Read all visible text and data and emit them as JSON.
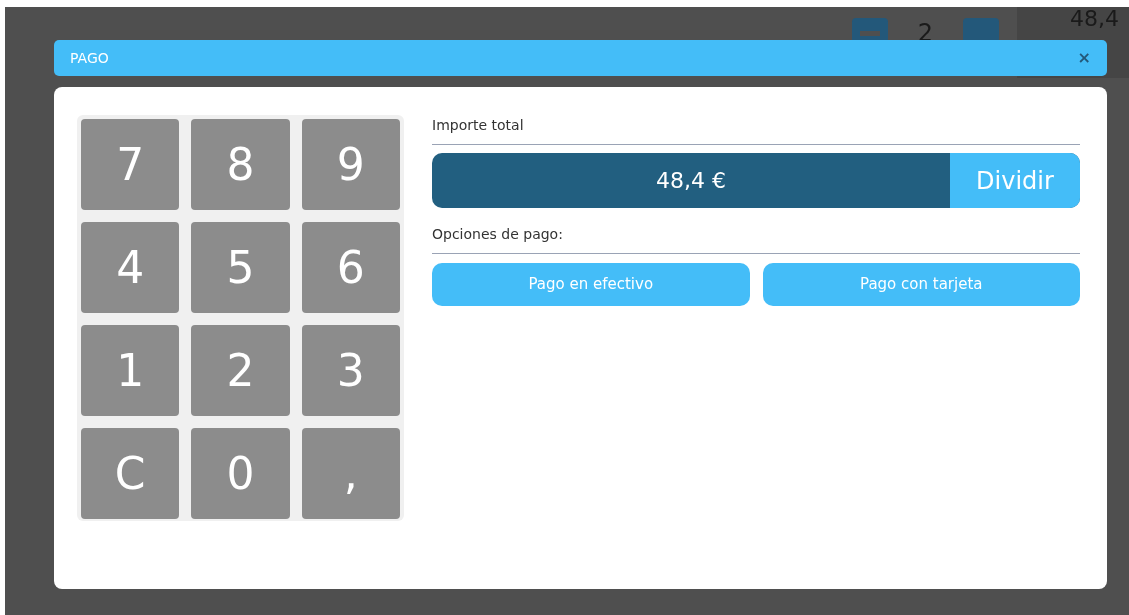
{
  "background": {
    "quantity": "2",
    "total": "48,4"
  },
  "dialog": {
    "title": "PAGO",
    "close": "×"
  },
  "keypad": [
    "7",
    "8",
    "9",
    "4",
    "5",
    "6",
    "1",
    "2",
    "3",
    "C",
    "0",
    ","
  ],
  "total": {
    "label": "Importe total",
    "amount": "48,4 €",
    "split_button": "Dividir"
  },
  "payment": {
    "label": "Opciones de pago:",
    "options": [
      "Pago en efectivo",
      "Pago con tarjeta"
    ]
  }
}
